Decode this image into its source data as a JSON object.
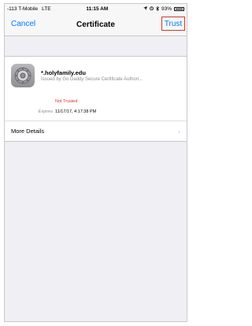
{
  "status_bar": {
    "carrier": "-113 T-Mobile",
    "network": "LTE",
    "time": "11:15 AM",
    "location_icon": "location-arrow-icon",
    "alarm_icon": "alarm-icon",
    "bluetooth_icon": "bluetooth-icon",
    "battery": "93%"
  },
  "navbar": {
    "cancel_label": "Cancel",
    "title": "Certificate",
    "trust_label": "Trust",
    "highlight_color": "#d33a2a",
    "accent_color": "#007aff"
  },
  "certificate": {
    "icon": "settings-gear-icon",
    "name": "*.holyfamily.edu",
    "issuer": "Issued by Go Daddy Secure Certificate Authori...",
    "status": "Not Trusted",
    "status_color": "#e0302a",
    "expires_label": "Expires",
    "expires_value": "11/17/17, 4:17:38 PM"
  },
  "more_details": {
    "label": "More Details",
    "chevron_icon": "chevron-right-icon"
  }
}
